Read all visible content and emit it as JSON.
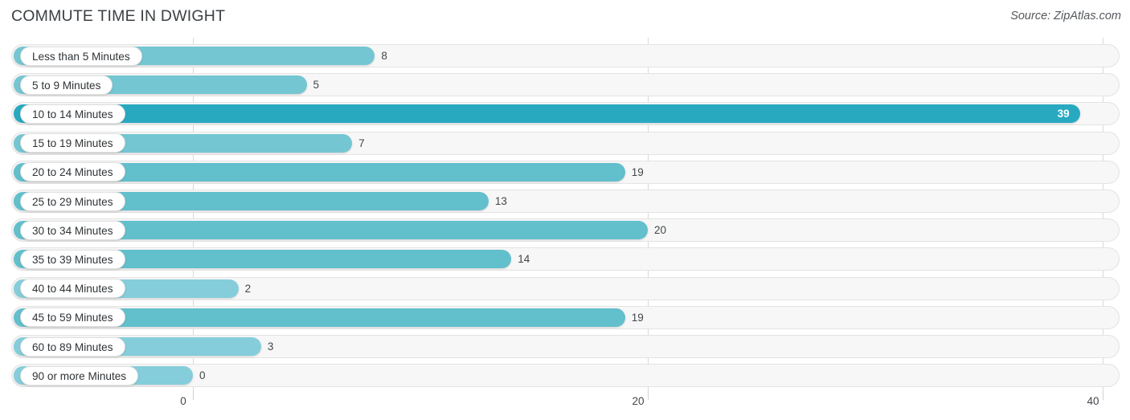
{
  "header": {
    "title": "COMMUTE TIME IN DWIGHT",
    "source": "Source: ZipAtlas.com"
  },
  "colors": {
    "bar_default": "#62bfcc",
    "bar_max": "#28a9c0",
    "bar_light": "#85cddb",
    "track_fill": "#f7f7f7",
    "track_border": "#e3e3e3",
    "gridline": "#d9d9d9",
    "text": "#43474b",
    "title": "#3c4043"
  },
  "chart_data": {
    "type": "bar",
    "orientation": "horizontal",
    "title": "COMMUTE TIME IN DWIGHT",
    "xlabel": "",
    "ylabel": "",
    "xlim": [
      0,
      40
    ],
    "grid": true,
    "legend": "none",
    "xticks": [
      0,
      20,
      40
    ],
    "xtick_labels": [
      "0",
      "20",
      "40"
    ],
    "categories": [
      "Less than 5 Minutes",
      "5 to 9 Minutes",
      "10 to 14 Minutes",
      "15 to 19 Minutes",
      "20 to 24 Minutes",
      "25 to 29 Minutes",
      "30 to 34 Minutes",
      "35 to 39 Minutes",
      "40 to 44 Minutes",
      "45 to 59 Minutes",
      "60 to 89 Minutes",
      "90 or more Minutes"
    ],
    "values": [
      8,
      5,
      39,
      7,
      19,
      13,
      20,
      14,
      2,
      19,
      3,
      0
    ],
    "value_labels": [
      "8",
      "5",
      "39",
      "7",
      "19",
      "13",
      "20",
      "14",
      "2",
      "19",
      "3",
      "0"
    ]
  }
}
